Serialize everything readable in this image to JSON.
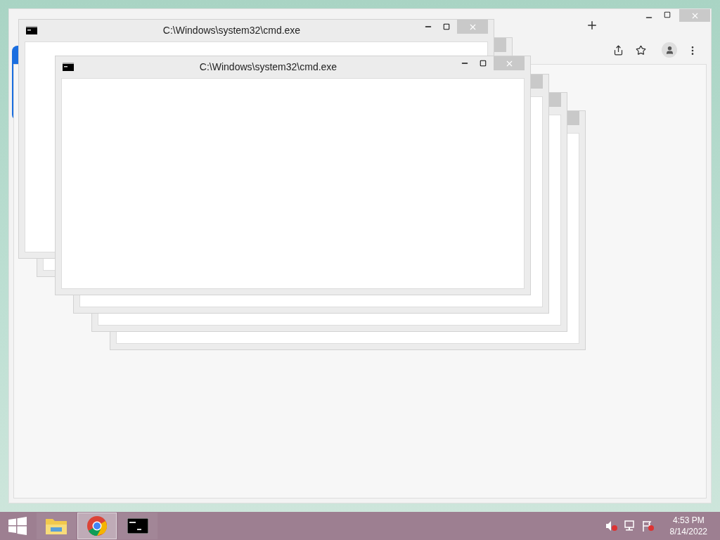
{
  "windows": [
    {
      "title": "C:\\Windows\\system32\\cmd.exe"
    },
    {
      "title": "C:\\Windows\\system32\\cmd.exe"
    }
  ],
  "taskbar": {
    "apps": [
      {
        "kind": "explorer",
        "selected": false
      },
      {
        "kind": "chrome",
        "selected": true
      },
      {
        "kind": "cmd",
        "selected": false
      }
    ],
    "time": "4:53 PM",
    "date": "8/14/2022"
  }
}
